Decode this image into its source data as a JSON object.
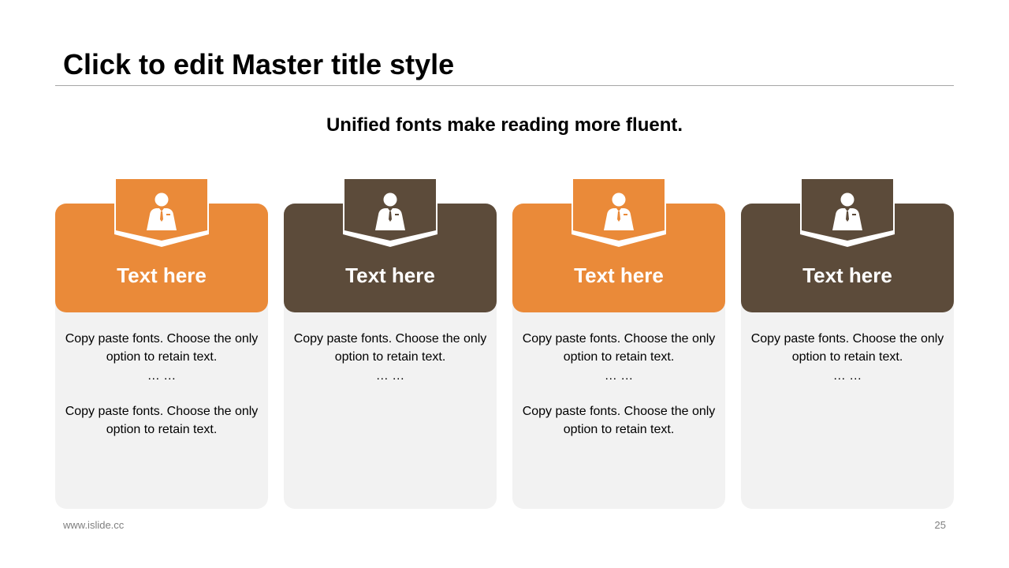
{
  "slide": {
    "title": "Click to edit Master title style",
    "subtitle": "Unified fonts make reading more fluent.",
    "footer_url": "www.islide.cc",
    "page_number": "25"
  },
  "colors": {
    "orange": "#ea8a39",
    "brown": "#5c4b3a",
    "card_body": "#f2f2f2"
  },
  "cards": [
    {
      "heading": "Text here",
      "icon": "person-icon",
      "para1": "Copy paste fonts. Choose the only option to retain text.",
      "ellipsis": "… …",
      "para2": "Copy paste fonts. Choose the only option to retain text."
    },
    {
      "heading": "Text here",
      "icon": "person-icon",
      "para1": "Copy paste fonts. Choose the only option to retain text.",
      "ellipsis": "… …"
    },
    {
      "heading": "Text here",
      "icon": "person-icon",
      "para1": "Copy paste fonts. Choose the only option to retain text.",
      "ellipsis": "… …",
      "para2": "Copy paste fonts. Choose the only option to retain text."
    },
    {
      "heading": "Text here",
      "icon": "person-icon",
      "para1": "Copy paste fonts. Choose the only option to retain text.",
      "ellipsis": "… …"
    }
  ]
}
